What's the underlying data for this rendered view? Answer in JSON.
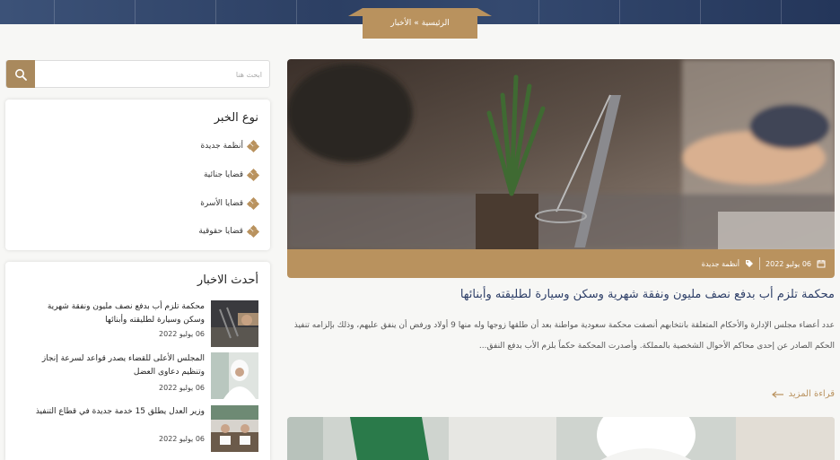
{
  "breadcrumb": {
    "home": "الرئيسية",
    "separator": "»",
    "current": "الأخبار"
  },
  "search": {
    "placeholder": "ابحث هنا",
    "icon": "search-icon"
  },
  "news_types": {
    "title": "نوع الخبر",
    "items": [
      "أنظمة جديدة",
      "قضايا جنائية",
      "قضايا الأسرة",
      "قضايا حقوقية"
    ]
  },
  "latest": {
    "title": "أحدث الاخبار",
    "items": [
      {
        "title": "محكمة تلزم أب بدفع نصف مليون ونفقة شهرية وسكن وسيارة لطليقته وأبنائها",
        "date": "06 يوليو 2022"
      },
      {
        "title": "المجلس الأعلى للقضاء يصدر قواعد لسرعة إنجاز وتنظيم دعاوى العضل",
        "date": "06 يوليو 2022"
      },
      {
        "title": "وزير العدل يطلق 15 خدمة جديدة في قطاع التنفيذ",
        "date": "06 يوليو 2022"
      }
    ]
  },
  "article": {
    "date": "06 يوليو 2022",
    "category": "أنظمة جديدة",
    "title": "محكمة تلزم أب بدفع نصف مليون ونفقة شهرية وسكن وسيارة لطليقته وأبنائها",
    "excerpt": "عدد أعضاء مجلس الإدارة والأحكام المتعلقة بانتخابهم أنصفت محكمة سعودية مواطنة بعد أن طلقها زوجها وله منها 9 أولاد ورفض أن ينفق عليهم، وذلك بإلزامه تنفيذ الحكم الصادر عن إحدى محاكم الأحوال الشخصية بالمملكة. وأصدرت المحكمة حكماً بلزم الأب بدفع النفق...",
    "read_more": "قراءة المزيد"
  },
  "colors": {
    "accent": "#b9925e",
    "title": "#2e3f68",
    "hero": "#2c3f63"
  }
}
